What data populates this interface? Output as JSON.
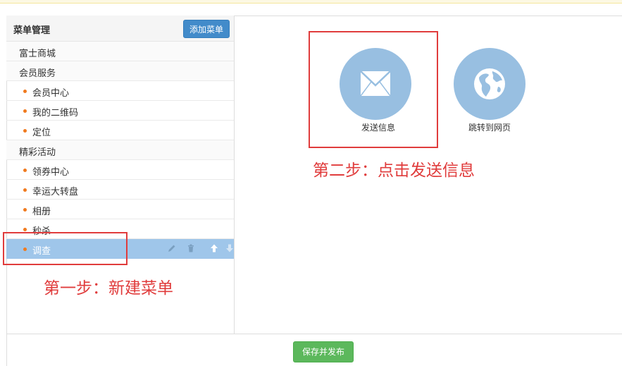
{
  "sidebar": {
    "title": "菜单管理",
    "add_button": "添加菜单",
    "items": [
      {
        "label": "富士商城",
        "level": "group"
      },
      {
        "label": "会员服务",
        "level": "group"
      },
      {
        "label": "会员中心",
        "level": "sub"
      },
      {
        "label": "我的二维码",
        "level": "sub"
      },
      {
        "label": "定位",
        "level": "sub"
      },
      {
        "label": "精彩活动",
        "level": "group"
      },
      {
        "label": "领券中心",
        "level": "sub"
      },
      {
        "label": "幸运大转盘",
        "level": "sub"
      },
      {
        "label": "相册",
        "level": "sub"
      },
      {
        "label": "秒杀",
        "level": "sub"
      },
      {
        "label": "调查",
        "level": "sub",
        "active": true
      }
    ]
  },
  "actions": {
    "send_message": "发送信息",
    "jump_webpage": "跳转到网页"
  },
  "annotations": {
    "step1": "第一步：新建菜单",
    "step2": "第二步：点击发送信息"
  },
  "footer": {
    "save_publish": "保存并发布"
  },
  "colors": {
    "primary": "#428bca",
    "success": "#5cb85c",
    "active_row": "#9fc6ea",
    "circle": "#98bfe1",
    "annotation": "#e03c3c",
    "bullet": "#f07a1e"
  }
}
